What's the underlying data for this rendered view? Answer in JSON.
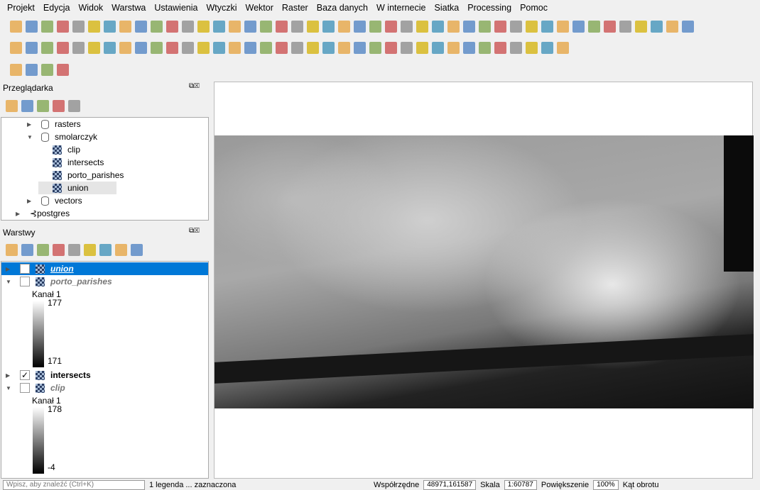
{
  "menu": [
    "Projekt",
    "Edycja",
    "Widok",
    "Warstwa",
    "Ustawienia",
    "Wtyczki",
    "Wektor",
    "Raster",
    "Baza danych",
    "W internecie",
    "Siatka",
    "Processing",
    "Pomoc"
  ],
  "browser": {
    "title": "Przeglądarka",
    "items": [
      {
        "label": "rasters",
        "type": "db",
        "level": 2,
        "expanded": false
      },
      {
        "label": "smolarczyk",
        "type": "db",
        "level": 2,
        "expanded": true
      },
      {
        "label": "clip",
        "type": "raster",
        "level": 3
      },
      {
        "label": "intersects",
        "type": "raster",
        "level": 3
      },
      {
        "label": "porto_parishes",
        "type": "raster",
        "level": 3
      },
      {
        "label": "union",
        "type": "raster",
        "level": 3,
        "selected": true
      },
      {
        "label": "vectors",
        "type": "db",
        "level": 2,
        "expanded": false
      },
      {
        "label": "postgres",
        "type": "pg",
        "level": 1,
        "expanded": false
      }
    ]
  },
  "layers": {
    "title": "Warstwy",
    "items": [
      {
        "label": "union",
        "checked": false,
        "selected": true
      },
      {
        "label": "porto_parishes",
        "checked": false,
        "legend": {
          "band": "Kanał 1",
          "max": "177",
          "min": "171"
        }
      },
      {
        "label": "intersects",
        "checked": true
      },
      {
        "label": "clip",
        "checked": false,
        "legend": {
          "band": "Kanał 1",
          "max": "178",
          "min": "-4"
        }
      }
    ]
  },
  "status": {
    "search_placeholder": "Wpisz, aby znaleźć (Ctrl+K)",
    "legend_msg": "1 legenda ... zaznaczona",
    "coord_label": "Współrzędne",
    "coord": "48971,161587",
    "scale_label": "Skala",
    "scale": "1:60787",
    "magnifier_label": "Powiększenie",
    "magnifier": "100%",
    "rotation_label": "Kąt obrotu"
  },
  "colors": {
    "selection": "#0078d7"
  }
}
